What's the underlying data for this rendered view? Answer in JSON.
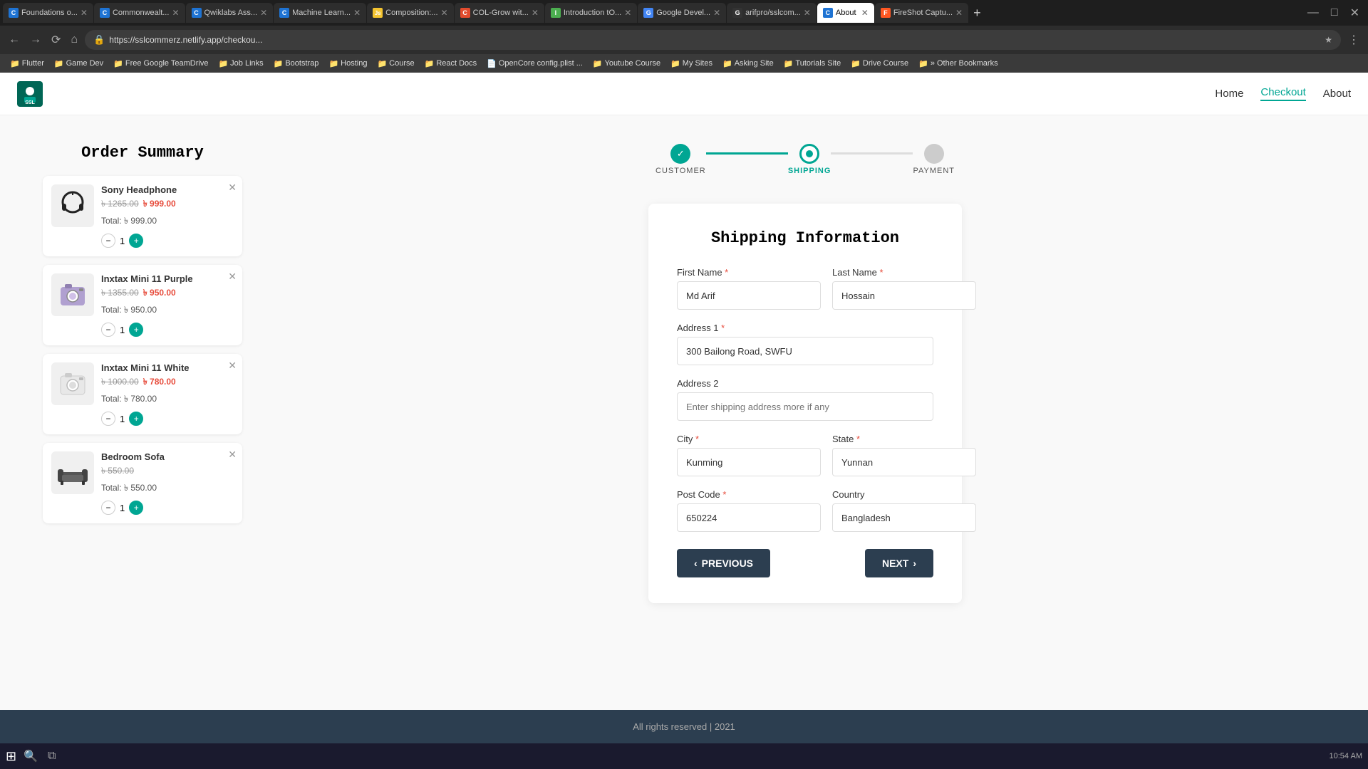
{
  "browser": {
    "tabs": [
      {
        "id": 1,
        "label": "Foundations o...",
        "favicon_color": "#1e73d3",
        "favicon_letter": "C",
        "active": false
      },
      {
        "id": 2,
        "label": "Commonwealt...",
        "favicon_color": "#1e73d3",
        "favicon_letter": "C",
        "active": false
      },
      {
        "id": 3,
        "label": "Qwiklabs Ass...",
        "favicon_color": "#1e73d3",
        "favicon_letter": "C",
        "active": false
      },
      {
        "id": 4,
        "label": "Machine Learn...",
        "favicon_color": "#1e73d3",
        "favicon_letter": "C",
        "active": false
      },
      {
        "id": 5,
        "label": "Composition:...",
        "favicon_color": "#f4c430",
        "favicon_letter": "Js",
        "active": false
      },
      {
        "id": 6,
        "label": "COL-Grow wit...",
        "favicon_color": "#e34c2e",
        "favicon_letter": "C",
        "active": false
      },
      {
        "id": 7,
        "label": "Introduction t o...",
        "favicon_color": "#4caf50",
        "favicon_letter": "I",
        "active": false
      },
      {
        "id": 8,
        "label": "Google Devel...",
        "favicon_color": "#4285f4",
        "favicon_letter": "G",
        "active": false
      },
      {
        "id": 9,
        "label": "arifpro/sslcom...",
        "favicon_color": "#333",
        "favicon_letter": "G",
        "active": false
      },
      {
        "id": 10,
        "label": "About",
        "favicon_color": "#1e73d3",
        "favicon_letter": "C",
        "active": true
      },
      {
        "id": 11,
        "label": "FireShot Captu...",
        "favicon_color": "#ff5722",
        "favicon_letter": "F",
        "active": false
      }
    ],
    "address": "https://sslcommerz.netlify.app/checkou...",
    "bookmarks": [
      {
        "label": "Flutter",
        "icon": "📁"
      },
      {
        "label": "Game Dev",
        "icon": "📁"
      },
      {
        "label": "Free Google TeamDrive",
        "icon": "📁"
      },
      {
        "label": "Job Links",
        "icon": "📁"
      },
      {
        "label": "Bootstrap",
        "icon": "📁"
      },
      {
        "label": "Hosting",
        "icon": "📁"
      },
      {
        "label": "Course",
        "icon": "📁"
      },
      {
        "label": "React Docs",
        "icon": "📁"
      },
      {
        "label": "OpenCore config.plist ...",
        "icon": "📄"
      },
      {
        "label": "Youtube Course",
        "icon": "📁"
      },
      {
        "label": "My Sites",
        "icon": "📁"
      },
      {
        "label": "Asking Site",
        "icon": "📁"
      },
      {
        "label": "Tutorials Site",
        "icon": "📁"
      },
      {
        "label": "Drive Course",
        "icon": "📁"
      },
      {
        "label": "Other Bookmarks",
        "icon": "📁"
      }
    ]
  },
  "app": {
    "logo_alt": "SSLCommerz",
    "nav": {
      "links": [
        {
          "label": "Home",
          "active": false
        },
        {
          "label": "Checkout",
          "active": true
        },
        {
          "label": "About",
          "active": false
        }
      ]
    }
  },
  "order_summary": {
    "title": "Order Summary",
    "items": [
      {
        "name": "Sony Headphone",
        "original_price": "৳ 1265.00",
        "sale_price": "৳ 999.00",
        "total": "Total: ৳ 999.00",
        "qty": 1
      },
      {
        "name": "Inxtax Mini 11 Purple",
        "original_price": "৳ 1355.00",
        "sale_price": "৳ 950.00",
        "total": "Total: ৳ 950.00",
        "qty": 1
      },
      {
        "name": "Inxtax Mini 11 White",
        "original_price": "৳ 1000.00",
        "sale_price": "৳ 780.00",
        "total": "Total: ৳ 780.00",
        "qty": 1
      },
      {
        "name": "Bedroom Sofa",
        "original_price": "",
        "sale_price": "",
        "price_single": "৳ 550.00",
        "total": "Total: ৳ 550.00",
        "qty": 1
      }
    ]
  },
  "checkout": {
    "steps": [
      {
        "label": "CUSTOMER",
        "state": "done"
      },
      {
        "label": "SHIPPING",
        "state": "active"
      },
      {
        "label": "PAYMENT",
        "state": "inactive"
      }
    ],
    "form": {
      "title": "Shipping Information",
      "fields": {
        "first_name": {
          "label": "First Name",
          "required": true,
          "value": "Md Arif"
        },
        "last_name": {
          "label": "Last Name",
          "required": true,
          "value": "Hossain"
        },
        "address1": {
          "label": "Address 1",
          "required": true,
          "value": "300 Bailong Road, SWFU"
        },
        "address2": {
          "label": "Address 2",
          "required": false,
          "placeholder": "Enter shipping address more if any",
          "value": ""
        },
        "city": {
          "label": "City",
          "required": true,
          "value": "Kunming"
        },
        "state": {
          "label": "State",
          "required": true,
          "value": "Yunnan"
        },
        "post_code": {
          "label": "Post Code",
          "required": true,
          "value": "650224"
        },
        "country": {
          "label": "Country",
          "required": false,
          "value": "Bangladesh"
        }
      },
      "btn_previous": "PREVIOUS",
      "btn_next": "NEXT"
    }
  },
  "footer": {
    "text": "All rights reserved | 2021"
  },
  "taskbar": {
    "time": "10:54 AM"
  }
}
